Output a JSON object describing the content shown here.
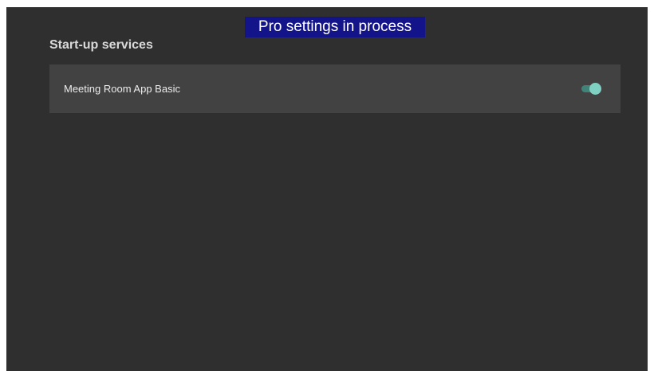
{
  "banner": {
    "text": "Pro settings in process"
  },
  "section": {
    "title": "Start-up services"
  },
  "services": [
    {
      "label": "Meeting Room App Basic",
      "enabled": true
    }
  ],
  "colors": {
    "background": "#2f2f2f",
    "row_background": "#424242",
    "banner_background": "#14148a",
    "toggle_on_thumb": "#7fd2c3",
    "toggle_on_track": "#3f8379"
  }
}
